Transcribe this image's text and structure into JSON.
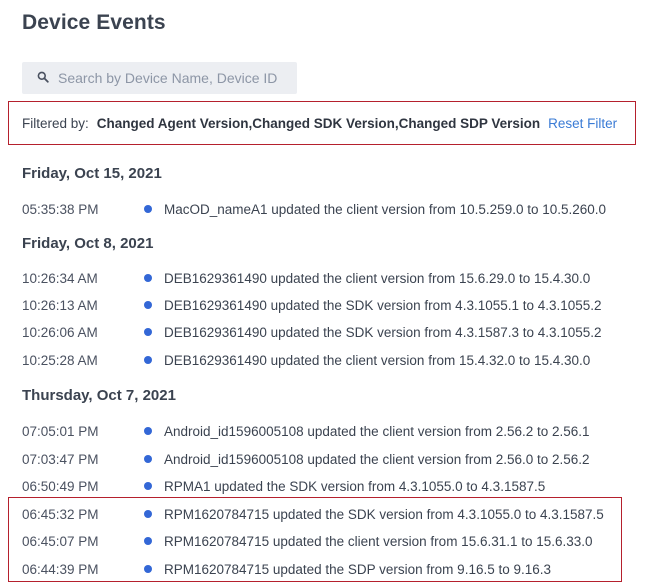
{
  "page": {
    "title": "Device Events"
  },
  "search": {
    "placeholder": "Search by Device Name, Device ID",
    "value": "",
    "icon": "search-icon"
  },
  "filter": {
    "label": "Filtered by:",
    "value": "Changed Agent Version,Changed SDK Version,Changed SDP Version",
    "reset_label": "Reset Filter"
  },
  "colors": {
    "accent": "#3a7bd5",
    "event_dot": "#3367d6",
    "highlight_border": "#b5202d"
  },
  "groups": [
    {
      "date": "Friday, Oct 15, 2021",
      "events": [
        {
          "time": "05:35:38 PM",
          "text": "MacOD_nameA1 updated the client version from 10.5.259.0 to 10.5.260.0"
        }
      ]
    },
    {
      "date": "Friday, Oct 8, 2021",
      "events": [
        {
          "time": "10:26:34 AM",
          "text": "DEB1629361490 updated the client version from 15.6.29.0 to 15.4.30.0"
        },
        {
          "time": "10:26:13 AM",
          "text": "DEB1629361490 updated the SDK version from 4.3.1055.1 to 4.3.1055.2"
        },
        {
          "time": "10:26:06 AM",
          "text": "DEB1629361490 updated the SDK version from 4.3.1587.3 to 4.3.1055.2"
        },
        {
          "time": "10:25:28 AM",
          "text": "DEB1629361490 updated the client version from 15.4.32.0 to 15.4.30.0"
        }
      ]
    },
    {
      "date": "Thursday, Oct 7, 2021",
      "events": [
        {
          "time": "07:05:01 PM",
          "text": "Android_id1596005108 updated the client version from 2.56.2 to 2.56.1"
        },
        {
          "time": "07:03:47 PM",
          "text": "Android_id1596005108 updated the client version from 2.56.0 to 2.56.2"
        },
        {
          "time": "06:50:49 PM",
          "text": "RPMA1 updated the SDK version from 4.3.1055.0 to 4.3.1587.5"
        },
        {
          "time": "06:45:32 PM",
          "text": "RPM1620784715 updated the SDK version from 4.3.1055.0 to 4.3.1587.5"
        },
        {
          "time": "06:45:07 PM",
          "text": "RPM1620784715 updated the client version from 15.6.31.1 to 15.6.33.0"
        },
        {
          "time": "06:44:39 PM",
          "text": "RPM1620784715 updated the SDP version from 9.16.5 to 9.16.3"
        }
      ]
    }
  ]
}
